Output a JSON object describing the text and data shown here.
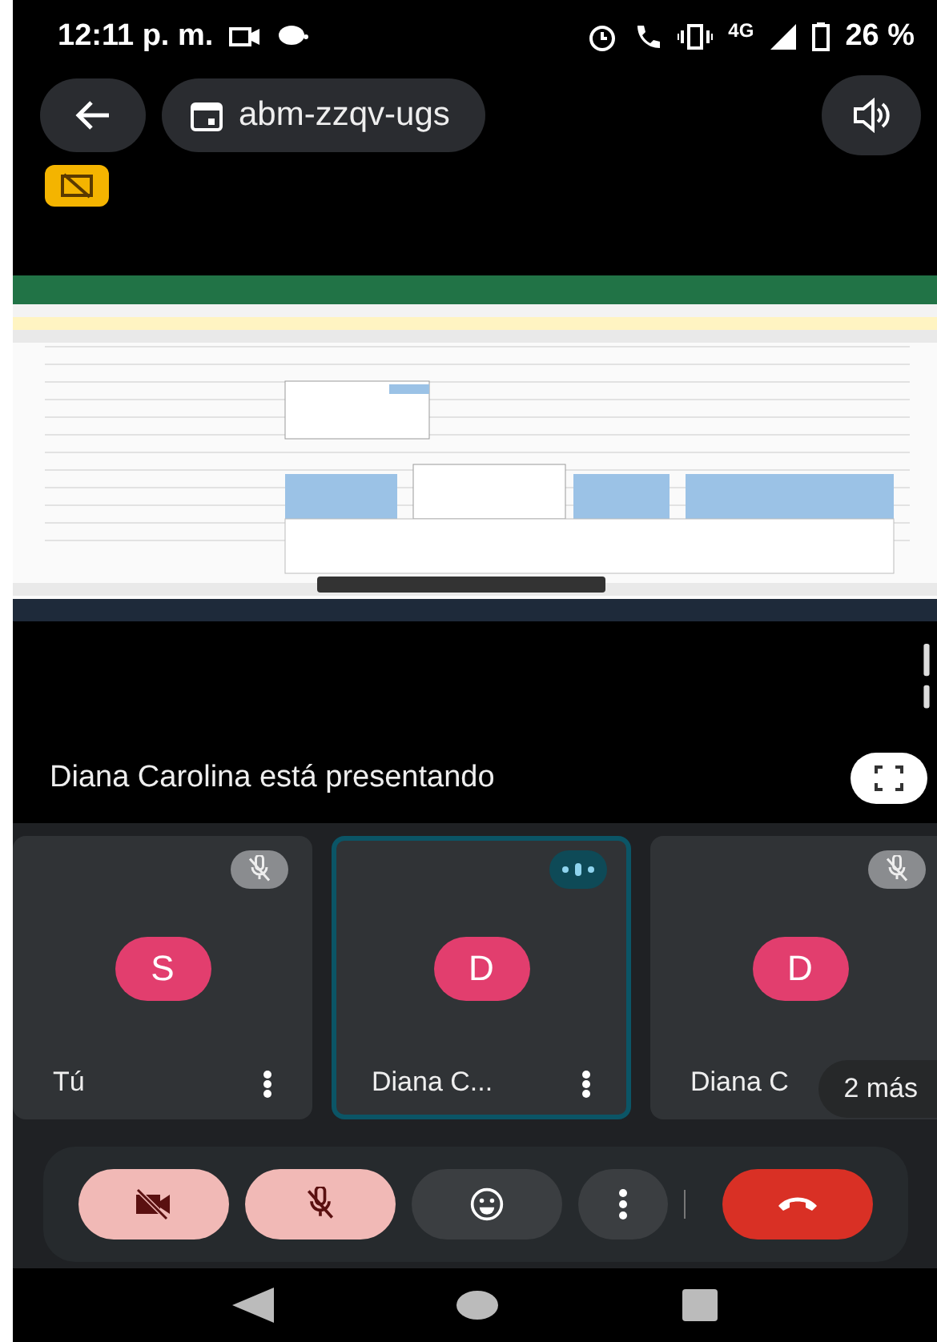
{
  "status_bar": {
    "time": "12:11 p. m.",
    "network": "4G",
    "battery": "26 %"
  },
  "top_bar": {
    "meeting_code": "abm-zzqv-ugs"
  },
  "presentation": {
    "kind": "picture",
    "presenter_text": "Diana Carolina está presentando"
  },
  "participants": [
    {
      "name": "Tú",
      "initial": "S",
      "muted": true,
      "selected": false
    },
    {
      "name": "Diana C...",
      "initial": "D",
      "muted": false,
      "selected": true
    },
    {
      "name": "Diana C",
      "initial": "D",
      "muted": true,
      "selected": false
    }
  ],
  "more_participants": "2 más",
  "controls": [
    {
      "kind": "camera",
      "on": false
    },
    {
      "kind": "mic",
      "on": false
    },
    {
      "kind": "reactions"
    },
    {
      "kind": "more"
    },
    {
      "kind": "hangup"
    }
  ]
}
